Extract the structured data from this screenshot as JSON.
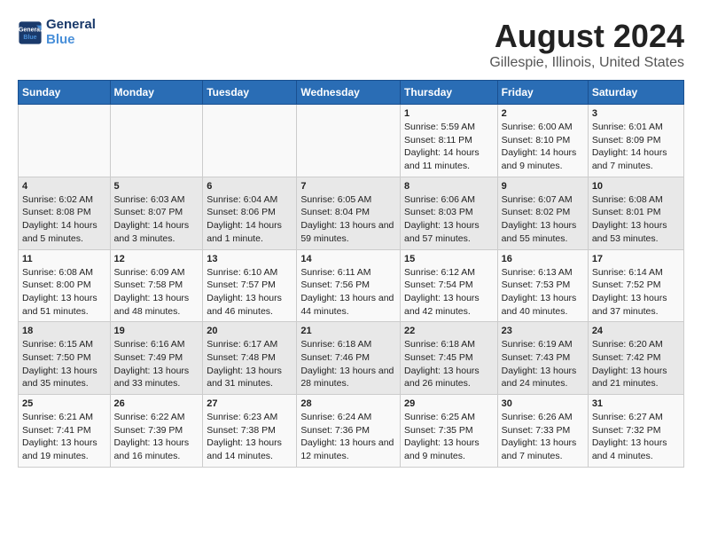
{
  "header": {
    "logo_line1": "General",
    "logo_line2": "Blue",
    "title": "August 2024",
    "subtitle": "Gillespie, Illinois, United States"
  },
  "days_of_week": [
    "Sunday",
    "Monday",
    "Tuesday",
    "Wednesday",
    "Thursday",
    "Friday",
    "Saturday"
  ],
  "weeks": [
    [
      {
        "day": "",
        "info": ""
      },
      {
        "day": "",
        "info": ""
      },
      {
        "day": "",
        "info": ""
      },
      {
        "day": "",
        "info": ""
      },
      {
        "day": "1",
        "info": "Sunrise: 5:59 AM\nSunset: 8:11 PM\nDaylight: 14 hours and 11 minutes."
      },
      {
        "day": "2",
        "info": "Sunrise: 6:00 AM\nSunset: 8:10 PM\nDaylight: 14 hours and 9 minutes."
      },
      {
        "day": "3",
        "info": "Sunrise: 6:01 AM\nSunset: 8:09 PM\nDaylight: 14 hours and 7 minutes."
      }
    ],
    [
      {
        "day": "4",
        "info": "Sunrise: 6:02 AM\nSunset: 8:08 PM\nDaylight: 14 hours and 5 minutes."
      },
      {
        "day": "5",
        "info": "Sunrise: 6:03 AM\nSunset: 8:07 PM\nDaylight: 14 hours and 3 minutes."
      },
      {
        "day": "6",
        "info": "Sunrise: 6:04 AM\nSunset: 8:06 PM\nDaylight: 14 hours and 1 minute."
      },
      {
        "day": "7",
        "info": "Sunrise: 6:05 AM\nSunset: 8:04 PM\nDaylight: 13 hours and 59 minutes."
      },
      {
        "day": "8",
        "info": "Sunrise: 6:06 AM\nSunset: 8:03 PM\nDaylight: 13 hours and 57 minutes."
      },
      {
        "day": "9",
        "info": "Sunrise: 6:07 AM\nSunset: 8:02 PM\nDaylight: 13 hours and 55 minutes."
      },
      {
        "day": "10",
        "info": "Sunrise: 6:08 AM\nSunset: 8:01 PM\nDaylight: 13 hours and 53 minutes."
      }
    ],
    [
      {
        "day": "11",
        "info": "Sunrise: 6:08 AM\nSunset: 8:00 PM\nDaylight: 13 hours and 51 minutes."
      },
      {
        "day": "12",
        "info": "Sunrise: 6:09 AM\nSunset: 7:58 PM\nDaylight: 13 hours and 48 minutes."
      },
      {
        "day": "13",
        "info": "Sunrise: 6:10 AM\nSunset: 7:57 PM\nDaylight: 13 hours and 46 minutes."
      },
      {
        "day": "14",
        "info": "Sunrise: 6:11 AM\nSunset: 7:56 PM\nDaylight: 13 hours and 44 minutes."
      },
      {
        "day": "15",
        "info": "Sunrise: 6:12 AM\nSunset: 7:54 PM\nDaylight: 13 hours and 42 minutes."
      },
      {
        "day": "16",
        "info": "Sunrise: 6:13 AM\nSunset: 7:53 PM\nDaylight: 13 hours and 40 minutes."
      },
      {
        "day": "17",
        "info": "Sunrise: 6:14 AM\nSunset: 7:52 PM\nDaylight: 13 hours and 37 minutes."
      }
    ],
    [
      {
        "day": "18",
        "info": "Sunrise: 6:15 AM\nSunset: 7:50 PM\nDaylight: 13 hours and 35 minutes."
      },
      {
        "day": "19",
        "info": "Sunrise: 6:16 AM\nSunset: 7:49 PM\nDaylight: 13 hours and 33 minutes."
      },
      {
        "day": "20",
        "info": "Sunrise: 6:17 AM\nSunset: 7:48 PM\nDaylight: 13 hours and 31 minutes."
      },
      {
        "day": "21",
        "info": "Sunrise: 6:18 AM\nSunset: 7:46 PM\nDaylight: 13 hours and 28 minutes."
      },
      {
        "day": "22",
        "info": "Sunrise: 6:18 AM\nSunset: 7:45 PM\nDaylight: 13 hours and 26 minutes."
      },
      {
        "day": "23",
        "info": "Sunrise: 6:19 AM\nSunset: 7:43 PM\nDaylight: 13 hours and 24 minutes."
      },
      {
        "day": "24",
        "info": "Sunrise: 6:20 AM\nSunset: 7:42 PM\nDaylight: 13 hours and 21 minutes."
      }
    ],
    [
      {
        "day": "25",
        "info": "Sunrise: 6:21 AM\nSunset: 7:41 PM\nDaylight: 13 hours and 19 minutes."
      },
      {
        "day": "26",
        "info": "Sunrise: 6:22 AM\nSunset: 7:39 PM\nDaylight: 13 hours and 16 minutes."
      },
      {
        "day": "27",
        "info": "Sunrise: 6:23 AM\nSunset: 7:38 PM\nDaylight: 13 hours and 14 minutes."
      },
      {
        "day": "28",
        "info": "Sunrise: 6:24 AM\nSunset: 7:36 PM\nDaylight: 13 hours and 12 minutes."
      },
      {
        "day": "29",
        "info": "Sunrise: 6:25 AM\nSunset: 7:35 PM\nDaylight: 13 hours and 9 minutes."
      },
      {
        "day": "30",
        "info": "Sunrise: 6:26 AM\nSunset: 7:33 PM\nDaylight: 13 hours and 7 minutes."
      },
      {
        "day": "31",
        "info": "Sunrise: 6:27 AM\nSunset: 7:32 PM\nDaylight: 13 hours and 4 minutes."
      }
    ]
  ]
}
